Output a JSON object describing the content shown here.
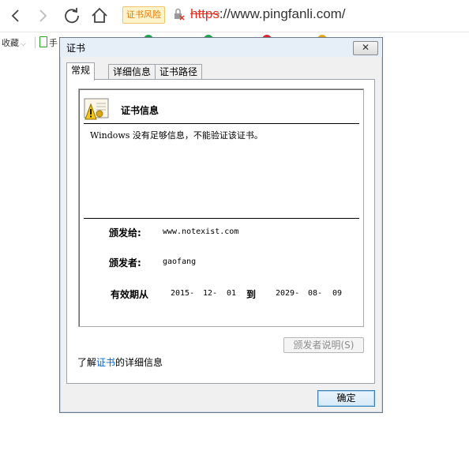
{
  "browser": {
    "risk_badge": "证书风险",
    "url_protocol": "https",
    "url_rest": "://www.pingfanli.com/",
    "bookmarks_label": "收藏",
    "bookmark_item": "手"
  },
  "dialog": {
    "title": "证书",
    "close_label": "✕",
    "tabs": [
      {
        "label": "常规",
        "active": true
      },
      {
        "label": "详细信息",
        "active": false
      },
      {
        "label": "证书路径",
        "active": false
      }
    ],
    "info_title": "证书信息",
    "warning": "Windows 没有足够信息，不能验证该证书。",
    "issued_to_label": "颁发给:",
    "issued_to_value": "www.notexist.com",
    "issued_by_label": "颁发者:",
    "issued_by_value": "gaofang",
    "valid_from_label": "有效期从",
    "valid_from": {
      "year": "2015-",
      "month": "12-",
      "day": "01"
    },
    "valid_to_label": "到",
    "valid_to": {
      "year": "2029-",
      "month": "08-",
      "day": "09"
    },
    "issuer_statement_button": "颁发者说明(S)",
    "learn_prefix": "了解",
    "learn_link": "证书",
    "learn_suffix": "的详细信息",
    "ok_button": "确定"
  },
  "colors": {
    "risk_text": "#e07b00",
    "protocol_strike": "#e0301e",
    "link": "#0066cc"
  }
}
